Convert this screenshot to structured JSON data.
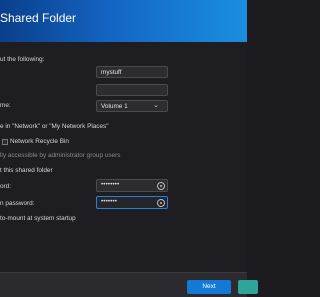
{
  "dialog": {
    "title": "Shared Folder"
  },
  "form": {
    "intro": "ut the following:",
    "name_value": "mystuff",
    "volume_label": "me:",
    "volume_value": "Volume 1",
    "hide_network": "e in \"Network\" or \"My Network Places\"",
    "recycle_bin": "Network Recycle Bin",
    "admin_only": "lly accessible by administrator group users",
    "encrypt": "t this shared folder",
    "password_label": "ord:",
    "confirm_label": "n password:",
    "password_dots": "••••••••",
    "confirm_dots": "•••••••",
    "automount": "to-mount at system startup"
  },
  "footer": {
    "next_label": "Next",
    "cancel_label": ""
  },
  "colors": {
    "accent": "#1479d6",
    "header_start": "#0a3f8a",
    "header_end": "#1a8fe0"
  }
}
